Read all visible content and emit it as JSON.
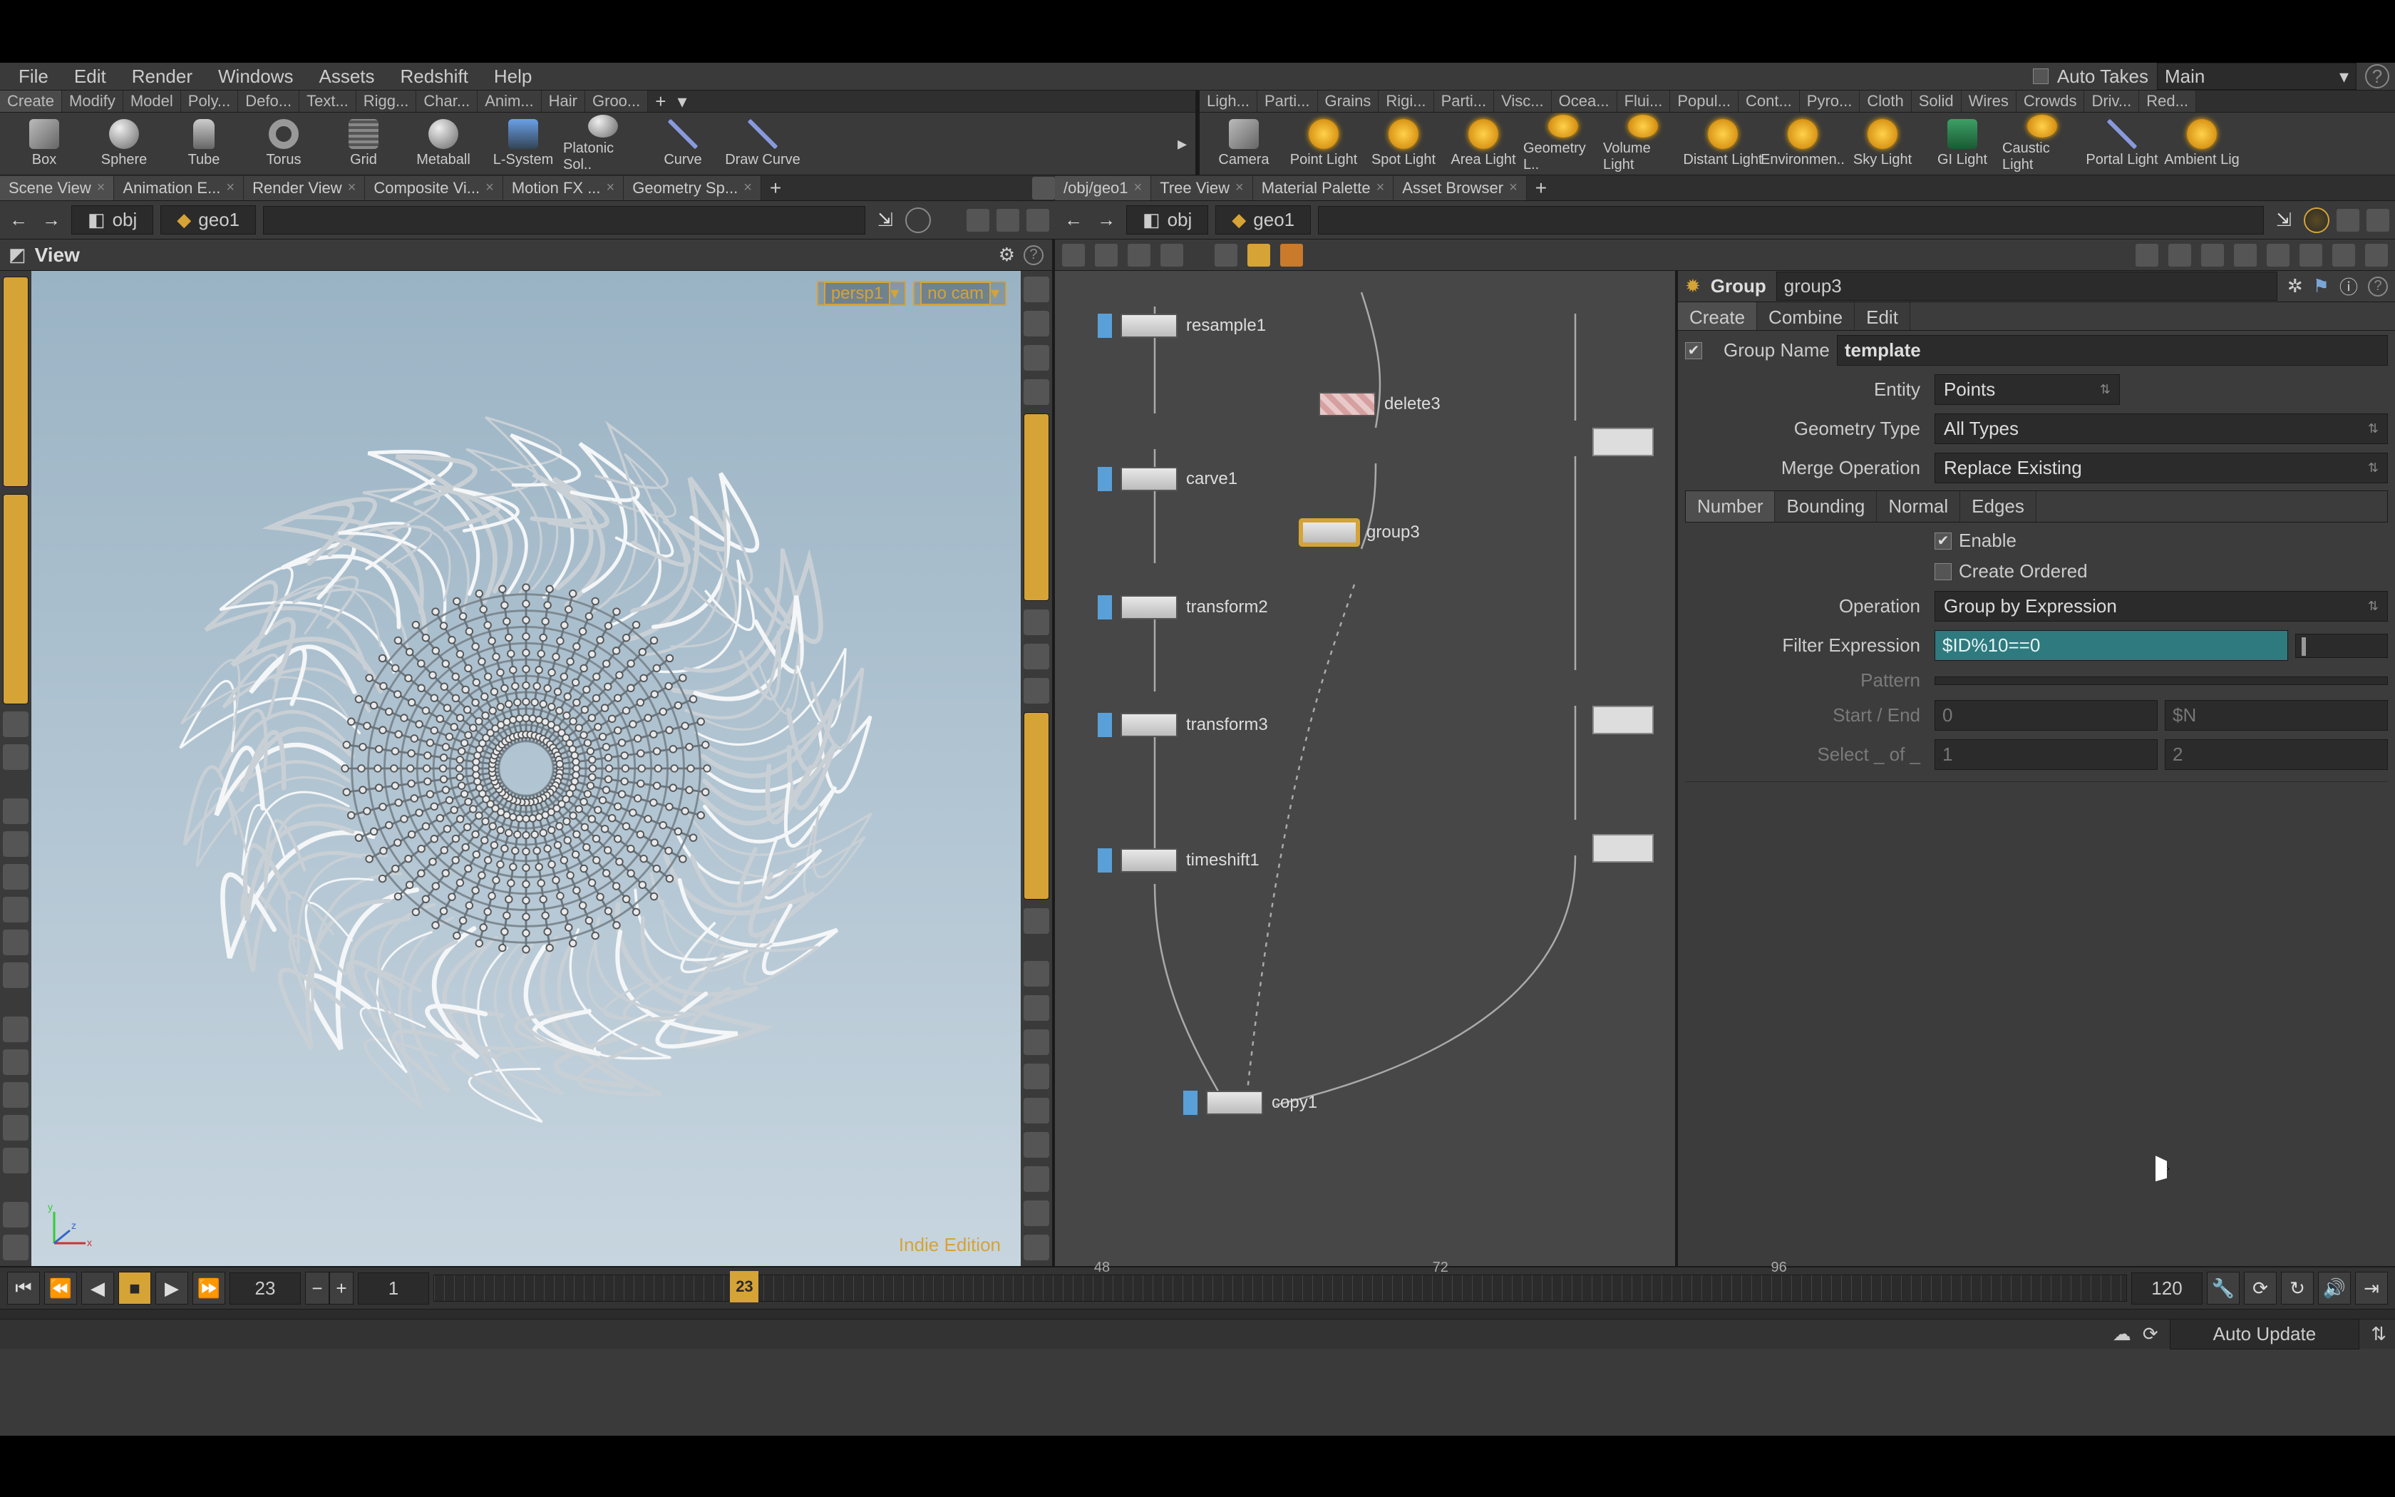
{
  "menubar": [
    "File",
    "Edit",
    "Render",
    "Windows",
    "Assets",
    "Redshift",
    "Help"
  ],
  "autotakes_label": "Auto Takes",
  "takes_selected": "Main",
  "shelf_left_tabs": [
    "Create",
    "Modify",
    "Model",
    "Poly...",
    "Defo...",
    "Text...",
    "Rigg...",
    "Char...",
    "Anim...",
    "Hair",
    "Groo..."
  ],
  "shelf_right_tabs": [
    "Ligh...",
    "Parti...",
    "Grains",
    "Rigi...",
    "Parti...",
    "Visc...",
    "Ocea...",
    "Flui...",
    "Popul...",
    "Cont...",
    "Pyro...",
    "Cloth",
    "Solid",
    "Wires",
    "Crowds",
    "Driv...",
    "Red..."
  ],
  "shelf_left_icons": [
    "Box",
    "Sphere",
    "Tube",
    "Torus",
    "Grid",
    "Metaball",
    "L-System",
    "Platonic Sol..",
    "Curve",
    "Draw Curve"
  ],
  "shelf_right_icons": [
    "Camera",
    "Point Light",
    "Spot Light",
    "Area Light",
    "Geometry L..",
    "Volume Light",
    "Distant Light",
    "Environmen..",
    "Sky Light",
    "GI Light",
    "Caustic Light",
    "Portal Light",
    "Ambient Lig"
  ],
  "left_tabs": [
    "Scene View",
    "Animation E...",
    "Render View",
    "Composite Vi...",
    "Motion FX ...",
    "Geometry Sp..."
  ],
  "right_tabs": [
    "/obj/geo1",
    "Tree View",
    "Material Palette",
    "Asset Browser"
  ],
  "path_left": {
    "seg1": "obj",
    "seg2": "geo1"
  },
  "path_right": {
    "seg1": "obj",
    "seg2": "geo1"
  },
  "view_title": "View",
  "hud": {
    "cam": "persp1",
    "camlabel": "no cam"
  },
  "edition": "Indie Edition",
  "nodes": {
    "resample1": "resample1",
    "delete3": "delete3",
    "carve1": "carve1",
    "group3": "group3",
    "transform2": "transform2",
    "transform3": "transform3",
    "timeshift1": "timeshift1",
    "copy1": "copy1"
  },
  "param": {
    "type": "Group",
    "name": "group3",
    "tabs": [
      "Create",
      "Combine",
      "Edit"
    ],
    "group_name_label": "Group Name",
    "group_name": "template",
    "entity_label": "Entity",
    "entity": "Points",
    "geomtype_label": "Geometry Type",
    "geomtype": "All Types",
    "mergeop_label": "Merge Operation",
    "mergeop": "Replace Existing",
    "subtabs": [
      "Number",
      "Bounding",
      "Normal",
      "Edges"
    ],
    "enable_label": "Enable",
    "create_ordered_label": "Create Ordered",
    "operation_label": "Operation",
    "operation": "Group by Expression",
    "filter_label": "Filter Expression",
    "filter": "$ID%10==0",
    "pattern_label": "Pattern",
    "startend_label": "Start / End",
    "startend_a": "0",
    "startend_b": "$N",
    "select_label": "Select _ of _",
    "select_a": "1",
    "select_b": "2"
  },
  "timeline": {
    "cur": "23",
    "start": "1",
    "end": "120",
    "ticks": [
      "48",
      "72",
      "96"
    ]
  },
  "status": {
    "auto_update": "Auto Update"
  }
}
